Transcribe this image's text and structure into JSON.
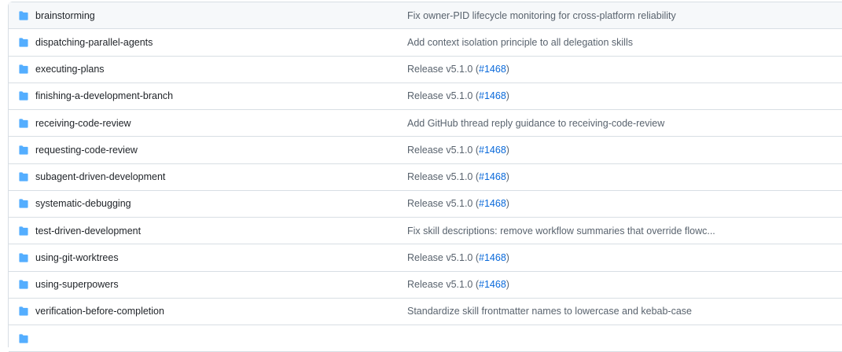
{
  "colors": {
    "folder": "#54aeff",
    "link": "#0969da",
    "name_text": "#1f2328",
    "commit_text": "#59636e",
    "border": "#d8dee4",
    "row_highlight": "#f6f8fa"
  },
  "rows": [
    {
      "name": "brainstorming",
      "commit": {
        "message": "Fix owner-PID lifecycle monitoring for cross-platform reliability",
        "pr": null,
        "suffix": ""
      }
    },
    {
      "name": "dispatching-parallel-agents",
      "commit": {
        "message": "Add context isolation principle to all delegation skills",
        "pr": null,
        "suffix": ""
      }
    },
    {
      "name": "executing-plans",
      "commit": {
        "message": "Release v5.1.0 (",
        "pr": "#1468",
        "suffix": ")"
      }
    },
    {
      "name": "finishing-a-development-branch",
      "commit": {
        "message": "Release v5.1.0 (",
        "pr": "#1468",
        "suffix": ")"
      }
    },
    {
      "name": "receiving-code-review",
      "commit": {
        "message": "Add GitHub thread reply guidance to receiving-code-review",
        "pr": null,
        "suffix": ""
      }
    },
    {
      "name": "requesting-code-review",
      "commit": {
        "message": "Release v5.1.0 (",
        "pr": "#1468",
        "suffix": ")"
      }
    },
    {
      "name": "subagent-driven-development",
      "commit": {
        "message": "Release v5.1.0 (",
        "pr": "#1468",
        "suffix": ")"
      }
    },
    {
      "name": "systematic-debugging",
      "commit": {
        "message": "Release v5.1.0 (",
        "pr": "#1468",
        "suffix": ")"
      }
    },
    {
      "name": "test-driven-development",
      "commit": {
        "message": "Fix skill descriptions: remove workflow summaries that override flowc...",
        "pr": null,
        "suffix": ""
      }
    },
    {
      "name": "using-git-worktrees",
      "commit": {
        "message": "Release v5.1.0 (",
        "pr": "#1468",
        "suffix": ")"
      }
    },
    {
      "name": "using-superpowers",
      "commit": {
        "message": "Release v5.1.0 (",
        "pr": "#1468",
        "suffix": ")"
      }
    },
    {
      "name": "verification-before-completion",
      "commit": {
        "message": "Standardize skill frontmatter names to lowercase and kebab-case",
        "pr": null,
        "suffix": ""
      }
    },
    {
      "name": "",
      "commit": {
        "message": "",
        "pr": null,
        "suffix": ""
      }
    }
  ],
  "row_icon": "folder-icon"
}
